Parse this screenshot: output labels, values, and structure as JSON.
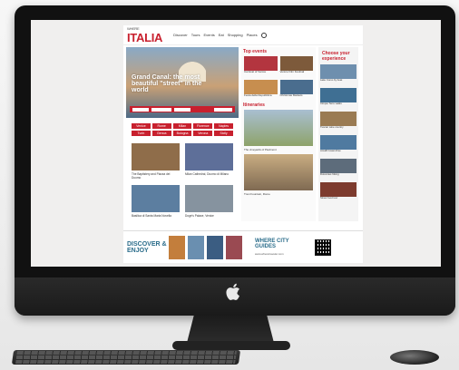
{
  "site": {
    "logo": "ITALIA",
    "logo_sub": "WHERE",
    "nav": [
      "Discover",
      "Tours",
      "Events",
      "Eat",
      "Shopping",
      "Places"
    ],
    "hero_title": "Grand Canal: the most beautiful \"street\" in the world",
    "tags": [
      "Venice",
      "Rome",
      "Milan",
      "Florence",
      "Naples",
      "Turin",
      "Genoa",
      "Bologna",
      "Verona",
      "Sicily"
    ],
    "cards": [
      {
        "caption": "The Baptistery and Piazza del Duomo",
        "color": "#8f6d4a"
      },
      {
        "caption": "Milan Cathedral, Duomo di Milano",
        "color": "#5e6f99"
      },
      {
        "caption": "Basilica di Santa Maria Novella",
        "color": "#5c7ea0"
      },
      {
        "caption": "Doge's Palace, Venice",
        "color": "#86939f"
      }
    ],
    "events_title": "Top events",
    "events": [
      {
        "caption": "Carnival of Venice",
        "color": "#b3353f"
      },
      {
        "caption": "Venice Film Festival",
        "color": "#7d5a3b"
      },
      {
        "caption": "Festa della Repubblica",
        "color": "#c78e4f"
      },
      {
        "caption": "Christmas Markets",
        "color": "#4a6d8e"
      }
    ],
    "itineraries_title": "Itineraries",
    "itinerary_1": "The vineyards of Piedmont",
    "itinerary_2": "Trevi Fountain, Rome",
    "right_title": "Choose your experience",
    "right_items": [
      {
        "caption": "Lake Como by boat",
        "color": "#6e8fae"
      },
      {
        "caption": "Cinque Terre walks",
        "color": "#3f6f93"
      },
      {
        "caption": "Tuscan wine country",
        "color": "#9a7b53"
      },
      {
        "caption": "Amalfi Coast drive",
        "color": "#4f7aa0"
      },
      {
        "caption": "Dolomites hiking",
        "color": "#5d6c7b"
      },
      {
        "caption": "Street food tour",
        "color": "#7d3b2e"
      }
    ]
  },
  "banner": {
    "discover": "DISCOVER & ENJOY",
    "where": "WHERE CITY GUIDES",
    "url": "www.wheretraveler.com",
    "books": [
      "#c37e3c",
      "#6a8fb0",
      "#3b5d82",
      "#9a4a52"
    ]
  },
  "colors": {
    "accent": "#c8202e",
    "banner_text": "#2a6c8a"
  }
}
